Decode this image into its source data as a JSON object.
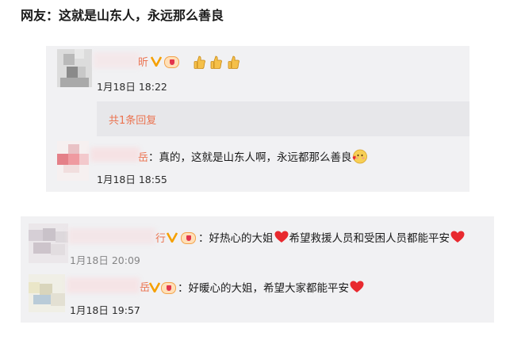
{
  "page": {
    "heading": "网友：这就是山东人，永远那么善良"
  },
  "thread1": {
    "comment": {
      "name_visible_tail": "昕",
      "emojis": [
        "thumbs-up-icon",
        "thumbs-up-icon",
        "thumbs-up-icon"
      ],
      "timestamp": "1月18日 18:22"
    },
    "reply_summary": "共1条回复",
    "reply": {
      "name_visible_tail": "岳",
      "text": "：真的，这就是山东人啊，永远都那么善良",
      "trailing_emoji": "blush-heart-icon",
      "timestamp": "1月18日 18:55"
    }
  },
  "thread2": {
    "comment1": {
      "name_visible_tail": "行",
      "text_a": "：好热心的大姐",
      "text_b": "希望救援人员和受困人员都能平安",
      "timestamp": "1月18日 20:09"
    },
    "comment2": {
      "name_visible_tail": "岳",
      "text": "：好暖心的大姐，希望大家都能平安",
      "timestamp": "1月18日 19:57"
    }
  },
  "colors": {
    "panel_bg": "#f1f1f3",
    "reply_bg": "#e7e7ea",
    "username": "#eb7350",
    "verified_badge": "#f5a000",
    "heart": "#e8292f"
  }
}
